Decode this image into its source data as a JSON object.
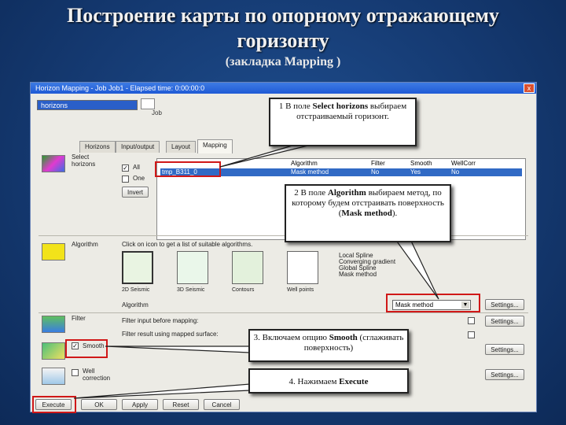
{
  "slide": {
    "title_line1": "Построение карты по опорному отражающему",
    "title_line2": "горизонту",
    "subtitle": "(закладка Mapping )"
  },
  "window": {
    "title": "Horizon Mapping - Job Job1 - Elapsed time: 0:00:00:0",
    "horizon_value": "horizons",
    "job_label": "Job",
    "close_glyph": "x"
  },
  "tabs": [
    "Horizons",
    "Input/output",
    "Layout",
    "Mapping"
  ],
  "select_horizons": {
    "label_line1": "Select",
    "label_line2": "horizons",
    "all_label": "All",
    "one_label": "One",
    "invert_label": "Invert",
    "columns": [
      "Algorithm",
      "Filter",
      "Smooth",
      "WellCorr"
    ],
    "row": {
      "horizon": "tmp_B311_0",
      "algorithm": "Mask method",
      "filter": "No",
      "smooth": "Yes",
      "wellcorr": "No"
    }
  },
  "algorithm": {
    "label": "Algorithm",
    "hint": "Click on icon to get a list of suitable algorithms.",
    "tiles": [
      "2D Seismic",
      "3D Seismic",
      "Contours",
      "Well points"
    ],
    "methods": [
      "Local Spline",
      "Converging gradient",
      "Global Spline",
      "Mask method"
    ],
    "field_label": "Algorithm",
    "selected": "Mask method",
    "settings": "Settings..."
  },
  "filter": {
    "label": "Filter",
    "text": "Filter input before mapping:",
    "settings": "Settings..."
  },
  "smooth": {
    "label": "Smooth",
    "text": "Filter result using mapped surface:",
    "settings": "Settings..."
  },
  "well_correction": {
    "label_line1": "Well",
    "label_line2": "correction",
    "settings": "Settings..."
  },
  "buttons": [
    "Execute",
    "OK",
    "Apply",
    "Reset",
    "Cancel"
  ],
  "callouts": {
    "c1_a": "1 В поле ",
    "c1_b": "Select horizons",
    "c1_c": " выбираем отстраиваемый горизонт.",
    "c2_a": "2 В поле ",
    "c2_b": "Algorithm",
    "c2_c": " выбираем метод, по которому будем отстраивать поверхность (",
    "c2_d": "Mask method",
    "c2_e": ").",
    "c3_a": "3. Включаем опцию ",
    "c3_b": "Smooth",
    "c3_c": " (сглаживать поверхность)",
    "c4_a": "4. Нажимаем ",
    "c4_b": "Execute"
  },
  "colors": {
    "highlight": "#d01818",
    "selection": "#316ac5",
    "background": "#153a72"
  }
}
